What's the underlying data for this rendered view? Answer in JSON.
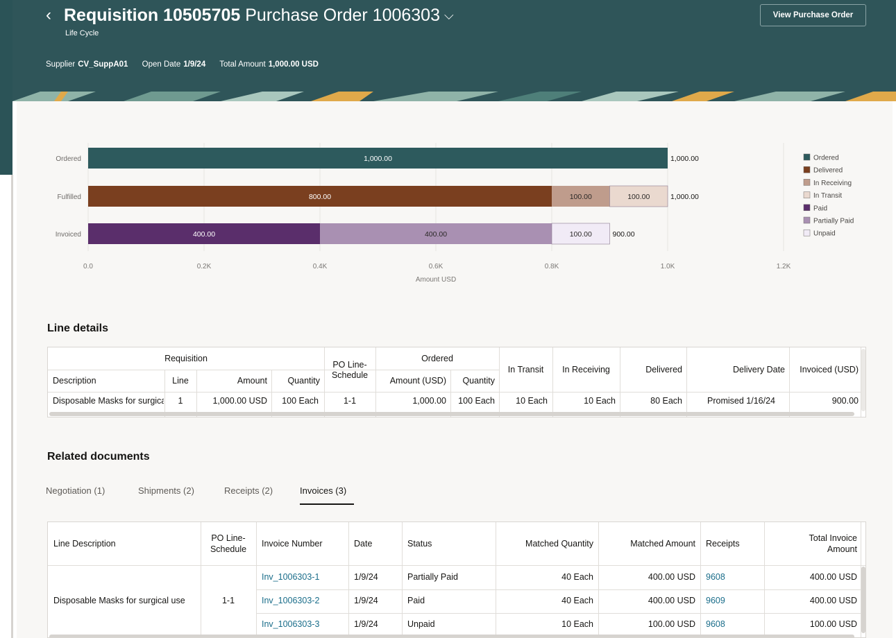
{
  "header": {
    "requisition_label": "Requisition 10505705",
    "po_label": "Purchase Order 1006303",
    "subtitle": "Life Cycle",
    "meta": [
      {
        "key": "Supplier",
        "value": "CV_SuppA01"
      },
      {
        "key": "Open Date",
        "value": "1/9/24"
      },
      {
        "key": "Total Amount",
        "value": "1,000.00 USD"
      }
    ],
    "view_po_button": "View Purchase Order"
  },
  "colors": {
    "header_bg": "#2f5559",
    "ordered": "#2d5a5d",
    "delivered": "#7a3f1f",
    "in_receiving": "#bf9c8c",
    "in_transit": "#ead9cf",
    "paid": "#5a2e6b",
    "partially_paid": "#a990b2",
    "unpaid": "#f1ebf6",
    "link": "#1a6d8a"
  },
  "chart_data": {
    "type": "bar",
    "orientation": "horizontal",
    "stacked": true,
    "categories": [
      "Ordered",
      "Fulfilled",
      "Invoiced"
    ],
    "xlabel": "Amount USD",
    "xlim": [
      0,
      1200
    ],
    "xticks": [
      "0.0",
      "0.2K",
      "0.4K",
      "0.6K",
      "0.8K",
      "1.0K",
      "1.2K"
    ],
    "grid": true,
    "legend_position": "right",
    "series": [
      {
        "name": "Ordered",
        "color": "#2d5a5d",
        "values": [
          1000,
          0,
          0
        ],
        "labels": [
          "1,000.00",
          "",
          ""
        ]
      },
      {
        "name": "Delivered",
        "color": "#7a3f1f",
        "values": [
          0,
          800,
          0
        ],
        "labels": [
          "",
          "800.00",
          ""
        ]
      },
      {
        "name": "In Receiving",
        "color": "#bf9c8c",
        "values": [
          0,
          100,
          0
        ],
        "labels": [
          "",
          "100.00",
          ""
        ]
      },
      {
        "name": "In Transit",
        "color": "#ead9cf",
        "values": [
          0,
          100,
          0
        ],
        "labels": [
          "",
          "100.00",
          ""
        ]
      },
      {
        "name": "Paid",
        "color": "#5a2e6b",
        "values": [
          0,
          0,
          400
        ],
        "labels": [
          "",
          "",
          "400.00"
        ]
      },
      {
        "name": "Partially Paid",
        "color": "#a990b2",
        "values": [
          0,
          0,
          400
        ],
        "labels": [
          "",
          "",
          "400.00"
        ]
      },
      {
        "name": "Unpaid",
        "color": "#f1ebf6",
        "values": [
          0,
          0,
          100
        ],
        "labels": [
          "",
          "",
          "100.00"
        ]
      }
    ],
    "totals": [
      "1,000.00",
      "1,000.00",
      "900.00"
    ]
  },
  "line_details": {
    "title": "Line details",
    "group_headers": {
      "requisition": "Requisition",
      "po_line_schedule": "PO Line-Schedule",
      "ordered": "Ordered"
    },
    "columns": [
      "Description",
      "Line",
      "Amount",
      "Quantity",
      "Amount (USD)",
      "Quantity",
      "In Transit",
      "In Receiving",
      "Delivered",
      "Delivery Date",
      "Invoiced (USD)"
    ],
    "po_line_schedule_lines": [
      "PO Line-",
      "Schedule"
    ],
    "row": {
      "description": "Disposable Masks for surgical use",
      "line": "1",
      "amount": "1,000.00 USD",
      "quantity": "100 Each",
      "po_line_schedule": "1-1",
      "ordered_amount": "1,000.00",
      "ordered_quantity": "100 Each",
      "in_transit": "10 Each",
      "in_receiving": "10 Each",
      "delivered": "80 Each",
      "delivery_date": "Promised 1/16/24",
      "invoiced": "900.00"
    }
  },
  "related": {
    "title": "Related documents",
    "tabs": [
      "Negotiation (1)",
      "Shipments (2)",
      "Receipts (2)",
      "Invoices (3)"
    ],
    "active_tab": "Invoices (3)",
    "columns": {
      "line_description": "Line Description",
      "po_line_schedule_1": "PO Line-",
      "po_line_schedule_2": "Schedule",
      "invoice_number": "Invoice Number",
      "date": "Date",
      "status": "Status",
      "matched_quantity": "Matched Quantity",
      "matched_amount": "Matched Amount",
      "receipts": "Receipts",
      "total_invoice_1": "Total Invoice",
      "total_invoice_2": "Amount"
    },
    "line_description": "Disposable Masks for surgical use",
    "po_line_schedule": "1-1",
    "rows": [
      {
        "invoice": "Inv_1006303-1",
        "date": "1/9/24",
        "status": "Partially Paid",
        "matched_qty": "40 Each",
        "matched_amount": "400.00 USD",
        "receipt": "9608",
        "total": "400.00 USD"
      },
      {
        "invoice": "Inv_1006303-2",
        "date": "1/9/24",
        "status": "Paid",
        "matched_qty": "40 Each",
        "matched_amount": "400.00 USD",
        "receipt": "9609",
        "total": "400.00 USD"
      },
      {
        "invoice": "Inv_1006303-3",
        "date": "1/9/24",
        "status": "Unpaid",
        "matched_qty": "10 Each",
        "matched_amount": "100.00 USD",
        "receipt": "9608",
        "total": "100.00 USD"
      }
    ]
  }
}
